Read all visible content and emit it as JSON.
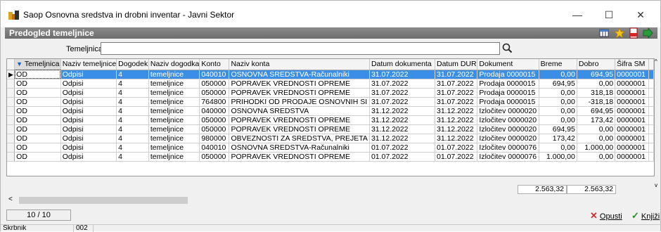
{
  "window": {
    "title": "Saop Osnovna sredstva in drobni inventar - Javni Sektor",
    "minimize": "—",
    "maximize": "☐",
    "close": "✕"
  },
  "header": {
    "title": "Predogled temeljnice"
  },
  "filter": {
    "label": "Temeljnica",
    "value": ""
  },
  "grid": {
    "columns": [
      "Temeljnica",
      "Naziv temeljnice",
      "Dogodek",
      "Naziv dogodka",
      "Konto",
      "Naziv konta",
      "Datum dokumenta",
      "Datum DUR",
      "Dokument",
      "Breme",
      "Dobro",
      "Šifra SM"
    ],
    "rows": [
      [
        "OD",
        "Odpisi",
        "4",
        "temeljnice",
        "040010",
        "OSNOVNA SREDSTVA-Računalniki",
        "31.07.2022",
        "31.07.2022",
        "Prodaja 0000015",
        "0,00",
        "694,95",
        "0000001"
      ],
      [
        "OD",
        "Odpisi",
        "4",
        "temeljnice",
        "050000",
        "POPRAVEK VREDNOSTI OPREME",
        "31.07.2022",
        "31.07.2022",
        "Prodaja 0000015",
        "694,95",
        "0,00",
        "0000001"
      ],
      [
        "OD",
        "Odpisi",
        "4",
        "temeljnice",
        "050000",
        "POPRAVEK VREDNOSTI OPREME",
        "31.07.2022",
        "31.07.2022",
        "Prodaja 0000015",
        "0,00",
        "318,18",
        "0000001"
      ],
      [
        "OD",
        "Odpisi",
        "4",
        "temeljnice",
        "764800",
        "PRIHODKI OD PRODAJE OSNOVNIH SI",
        "31.07.2022",
        "31.07.2022",
        "Prodaja 0000015",
        "0,00",
        "-318,18",
        "0000001"
      ],
      [
        "OD",
        "Odpisi",
        "4",
        "temeljnice",
        "040000",
        "OSNOVNA SREDSTVA",
        "31.12.2022",
        "31.12.2022",
        "Izločitev 0000020",
        "0,00",
        "694,95",
        "0000001"
      ],
      [
        "OD",
        "Odpisi",
        "4",
        "temeljnice",
        "050000",
        "POPRAVEK VREDNOSTI OPREME",
        "31.12.2022",
        "31.12.2022",
        "Izločitev 0000020",
        "0,00",
        "173,42",
        "0000001"
      ],
      [
        "OD",
        "Odpisi",
        "4",
        "temeljnice",
        "050000",
        "POPRAVEK VREDNOSTI OPREME",
        "31.12.2022",
        "31.12.2022",
        "Izločitev 0000020",
        "694,95",
        "0,00",
        "0000001"
      ],
      [
        "OD",
        "Odpisi",
        "4",
        "temeljnice",
        "980000",
        "OBVEZNOSTI ZA SREDSTVA, PREJETA",
        "31.12.2022",
        "31.12.2022",
        "Izločitev 0000020",
        "173,42",
        "0,00",
        "0000001"
      ],
      [
        "OD",
        "Odpisi",
        "4",
        "temeljnice",
        "040010",
        "OSNOVNA SREDSTVA-Računalniki",
        "01.07.2022",
        "01.07.2022",
        "Izločitev 0000076",
        "0,00",
        "1.000,00",
        "0000001"
      ],
      [
        "OD",
        "Odpisi",
        "4",
        "temeljnice",
        "050000",
        "POPRAVEK VREDNOSTI OPREME",
        "01.07.2022",
        "01.07.2022",
        "Izločitev 0000076",
        "1.000,00",
        "0,00",
        "0000001"
      ]
    ],
    "totals": {
      "breme": "2.563,32",
      "dobro": "2.563,32"
    }
  },
  "status": {
    "record_count": "10 / 10"
  },
  "actions": {
    "cancel": "Opusti",
    "post": "Knjiži"
  },
  "bottom": {
    "user": "Skrbnik",
    "code": "002"
  },
  "colors": {
    "selection": "#3a8ee6",
    "header": "#7a7a7a",
    "cancel": "#d82a2a",
    "ok": "#2a8a2a"
  }
}
